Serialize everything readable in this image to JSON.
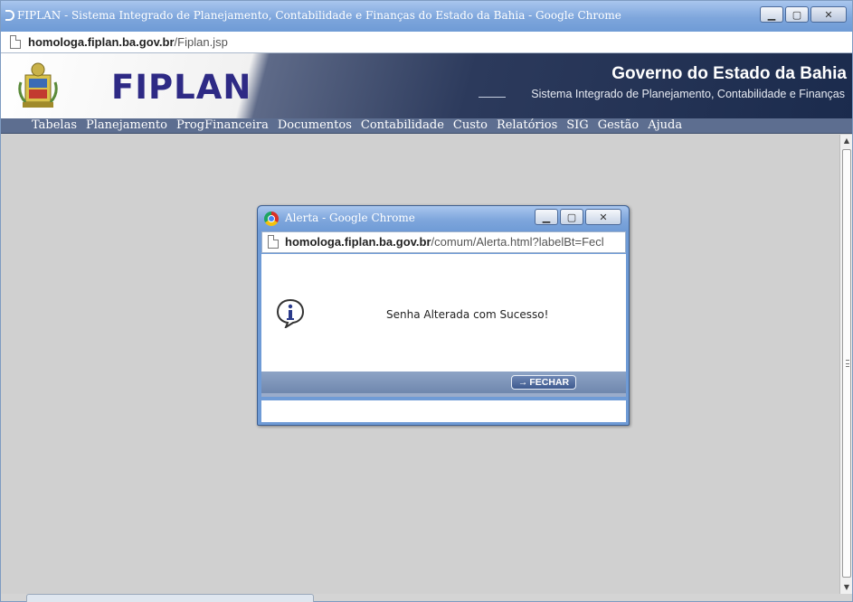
{
  "window": {
    "title": "FIPLAN - Sistema Integrado de Planejamento, Contabilidade e Finanças do Estado da Bahia - Google Chrome",
    "controls": {
      "minimize": "▁",
      "maximize": "▢",
      "close": "✕"
    }
  },
  "address": {
    "host": "homologa.fiplan.ba.gov.br",
    "path": "/Fiplan.jsp"
  },
  "header": {
    "logo": "FIPLAN",
    "government": "Governo do Estado da Bahia",
    "subtitle": "Sistema Integrado de Planejamento, Contabilidade e Finanças"
  },
  "menu": {
    "items": [
      "Tabelas",
      "Planejamento",
      "ProgFinanceira",
      "Documentos",
      "Contabilidade",
      "Custo",
      "Relatórios",
      "SIG",
      "Gestão",
      "Ajuda"
    ]
  },
  "popup": {
    "title": "Alerta - Google Chrome",
    "controls": {
      "minimize": "▁",
      "maximize": "▢",
      "close": "✕"
    },
    "address_host": "homologa.fiplan.ba.gov.br",
    "address_path": "/comum/Alerta.html?labelBt=Fecl",
    "message": "Senha Alterada com Sucesso!",
    "button_arrow": "→",
    "button_label": "FECHAR"
  },
  "colors": {
    "titlebar": "#7ea6dc",
    "menubar": "#5d6e90",
    "logo": "#2e2a85",
    "header_dark": "#1b2b4d"
  },
  "icons": [
    "page-icon",
    "crest-icon",
    "chrome-icon",
    "info-icon"
  ]
}
